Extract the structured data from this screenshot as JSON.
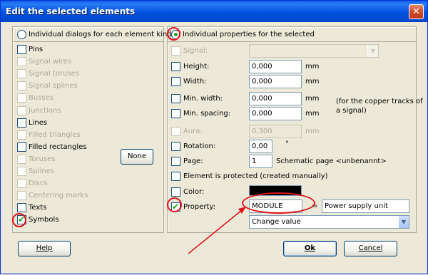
{
  "window": {
    "title": "Edit the selected elements",
    "close_glyph": "✕"
  },
  "left": {
    "radio_label": "Individual dialogs for each element kind",
    "none_button": "None",
    "items": [
      {
        "label": "Pins",
        "enabled": true,
        "checked": false
      },
      {
        "label": "Signal wires",
        "enabled": false,
        "checked": false
      },
      {
        "label": "Signal toruses",
        "enabled": false,
        "checked": false
      },
      {
        "label": "Signal splines",
        "enabled": false,
        "checked": false
      },
      {
        "label": "Busses",
        "enabled": false,
        "checked": false
      },
      {
        "label": "Junctions",
        "enabled": false,
        "checked": false
      },
      {
        "label": "Lines",
        "enabled": true,
        "checked": false
      },
      {
        "label": "Filled triangles",
        "enabled": false,
        "checked": false
      },
      {
        "label": "Filled rectangles",
        "enabled": true,
        "checked": false
      },
      {
        "label": "Toruses",
        "enabled": false,
        "checked": false
      },
      {
        "label": "Splines",
        "enabled": false,
        "checked": false
      },
      {
        "label": "Discs",
        "enabled": false,
        "checked": false
      },
      {
        "label": "Centering marks",
        "enabled": false,
        "checked": false
      },
      {
        "label": "Texts",
        "enabled": true,
        "checked": false
      },
      {
        "label": "Symbols",
        "enabled": true,
        "checked": true
      }
    ]
  },
  "right": {
    "radio_label": "Individual properties for the selected",
    "signal": {
      "label": "Signal:"
    },
    "height": {
      "label": "Height:",
      "value": "0,000",
      "unit": "mm"
    },
    "width": {
      "label": "Width:",
      "value": "0,000",
      "unit": "mm"
    },
    "min_width": {
      "label": "Min. width:",
      "value": "0,000",
      "unit": "mm"
    },
    "min_spacing": {
      "label": "Min. spacing:",
      "value": "0,000",
      "unit": "mm"
    },
    "copper_note_1": "(for the copper tracks of",
    "copper_note_2": "a signal)",
    "aura": {
      "label": "Aura:",
      "value": "0,300",
      "unit": "mm"
    },
    "rotation": {
      "label": "Rotation:",
      "value": "0,00",
      "unit": "°"
    },
    "page": {
      "label": "Page:",
      "value": "1",
      "note": "Schematic page <unbenannt>"
    },
    "protected": {
      "label": "Element is protected (created manually)"
    },
    "color": {
      "label": "Color:",
      "swatch": "#000000"
    },
    "property": {
      "label": "Property:",
      "checked": true,
      "name": "MODULE",
      "equals": "=",
      "value": "Power supply unit"
    },
    "change": {
      "value": "Change value"
    }
  },
  "footer": {
    "help": "Help",
    "ok": "Ok",
    "cancel": "Cancel"
  },
  "colors": {
    "title_bar": "#0054e3",
    "check_green": "#21a121",
    "annotation_red": "#e0131b"
  }
}
